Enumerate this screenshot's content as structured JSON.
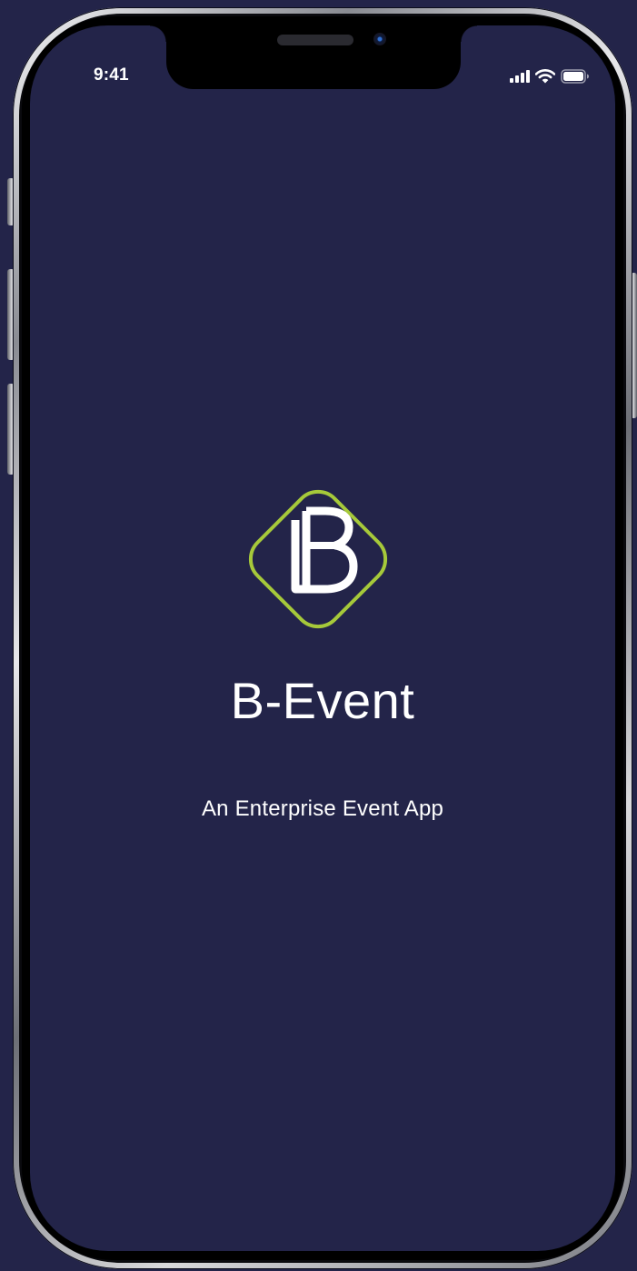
{
  "status_bar": {
    "time": "9:41",
    "icons": [
      "cellular-signal-icon",
      "wifi-icon",
      "battery-icon"
    ]
  },
  "splash": {
    "logo_letter": "B",
    "app_name": "B-Event",
    "tagline": "An Enterprise Event App"
  },
  "colors": {
    "background": "#232449",
    "logo_outline": "#a6c93a",
    "text": "#ffffff"
  }
}
